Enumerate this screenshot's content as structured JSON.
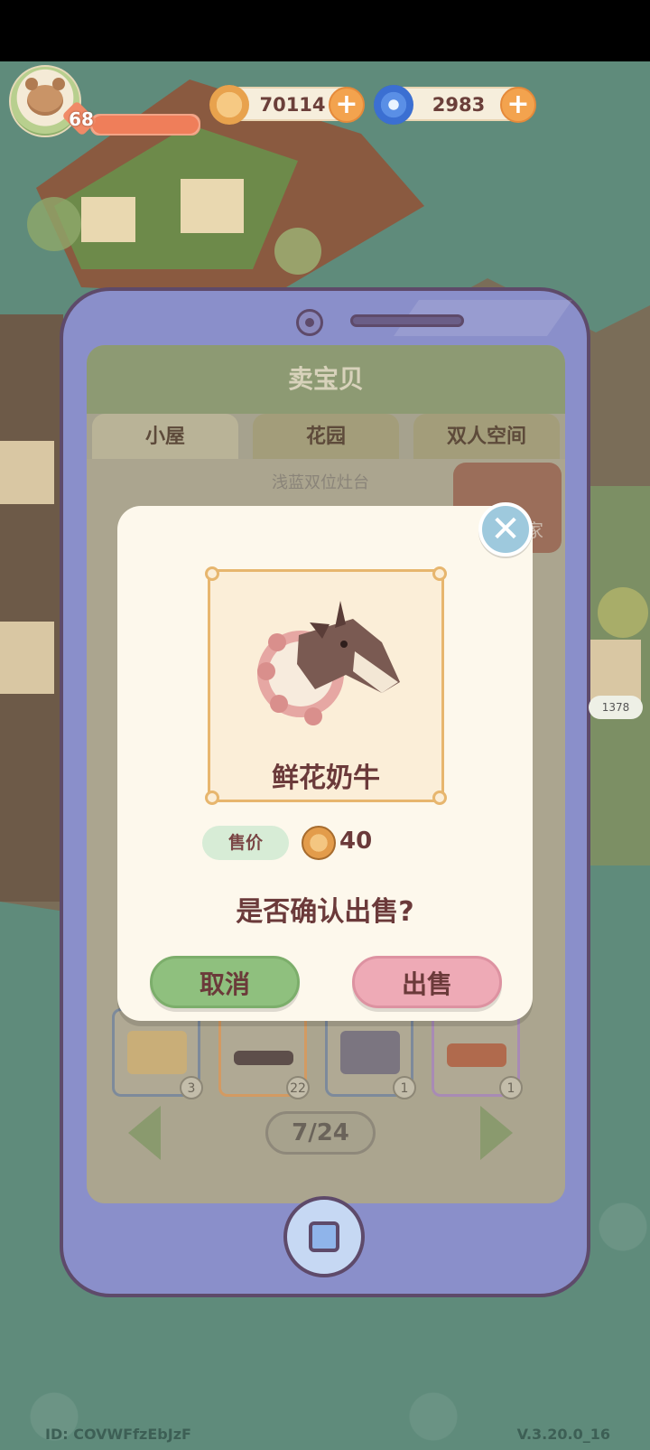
{
  "hud": {
    "level": "68",
    "xp_fraction": 1.0,
    "coins": "70114",
    "gems": "2983"
  },
  "phone": {
    "title": "卖宝贝",
    "tabs": [
      {
        "label": "小屋"
      },
      {
        "label": "花园"
      },
      {
        "label": "双人空间"
      }
    ],
    "bg_item_name": "浅蓝双位灶台",
    "bg_call_label": "呼唤买家",
    "grid_counts": [
      "3",
      "22",
      "1",
      "1"
    ],
    "page": "7/24",
    "side_badge": "1378"
  },
  "dialog": {
    "item_name": "鲜花奶牛",
    "price_label": "售价",
    "price_value": "40",
    "confirm_text": "是否确认出售?",
    "cancel_label": "取消",
    "sell_label": "出售"
  },
  "footer": {
    "id": "ID: COVWFfzEbJzF",
    "version": "V.3.20.0_16"
  },
  "colors": {
    "background": "#5f8b7b",
    "phone_frame": "#8a8fca",
    "cancel_button": "#8fc07e",
    "sell_button": "#eeaab6",
    "title_text": "#6b3a3a"
  }
}
